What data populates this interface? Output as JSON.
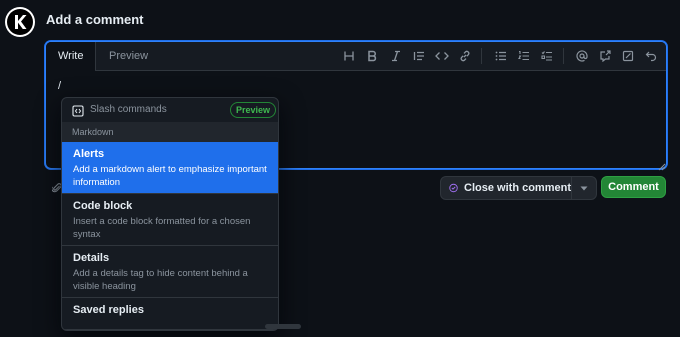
{
  "header": {
    "avatar_letter": "K",
    "title": "Add a comment"
  },
  "editor": {
    "tabs": [
      {
        "label": "Write",
        "active": true
      },
      {
        "label": "Preview",
        "active": false
      }
    ],
    "toolbar": [
      "heading-icon",
      "bold-icon",
      "italic-icon",
      "quote-icon",
      "code-icon",
      "link-icon",
      "unordered-list-icon",
      "ordered-list-icon",
      "task-list-icon",
      "mention-icon",
      "reference-icon",
      "saved-reply-icon",
      "undo-icon"
    ],
    "text_value": "/"
  },
  "slash_menu": {
    "title": "Slash commands",
    "badge": "Preview",
    "section": "Markdown",
    "items": [
      {
        "name": "Alerts",
        "description": "Add a markdown alert to emphasize important information",
        "selected": true
      },
      {
        "name": "Code block",
        "description": "Insert a code block formatted for a chosen syntax",
        "selected": false
      },
      {
        "name": "Details",
        "description": "Add a details tag to hide content behind a visible heading",
        "selected": false
      },
      {
        "name": "Saved replies",
        "description": "",
        "selected": false
      }
    ]
  },
  "actions": {
    "close_label": "Close with comment",
    "comment_label": "Comment"
  },
  "colors": {
    "background": "#0d1117",
    "accent": "#1f6feb",
    "primary_button": "#238636"
  }
}
